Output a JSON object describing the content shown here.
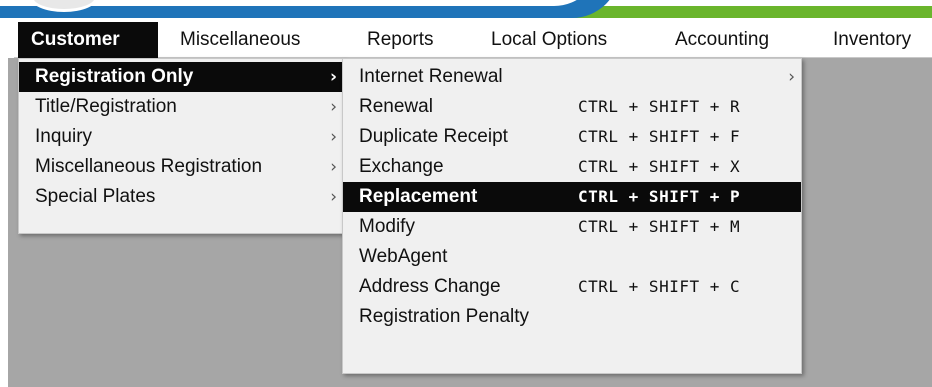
{
  "menubar": {
    "items": [
      {
        "label": "Customer"
      },
      {
        "label": "Miscellaneous"
      },
      {
        "label": "Reports"
      },
      {
        "label": "Local Options"
      },
      {
        "label": "Accounting"
      },
      {
        "label": "Inventory"
      }
    ]
  },
  "customer_menu": {
    "items": [
      {
        "label": "Registration Only",
        "chevron": "›",
        "highlighted": true
      },
      {
        "label": "Title/Registration",
        "chevron": "›"
      },
      {
        "label": "Inquiry",
        "chevron": "›"
      },
      {
        "label": "Miscellaneous Registration",
        "chevron": "›"
      },
      {
        "label": "Special Plates",
        "chevron": "›"
      }
    ]
  },
  "registration_submenu": {
    "items": [
      {
        "label": "Internet Renewal",
        "chevron": "›",
        "shortcut": ""
      },
      {
        "label": "Renewal",
        "shortcut": "CTRL + SHIFT + R"
      },
      {
        "label": "Duplicate Receipt",
        "shortcut": "CTRL + SHIFT + F"
      },
      {
        "label": "Exchange",
        "shortcut": "CTRL + SHIFT + X"
      },
      {
        "label": "Replacement",
        "shortcut": "CTRL + SHIFT + P",
        "highlighted": true
      },
      {
        "label": "Modify",
        "shortcut": "CTRL + SHIFT + M"
      },
      {
        "label": "WebAgent",
        "shortcut": ""
      },
      {
        "label": "Address Change",
        "shortcut": "CTRL + SHIFT + C"
      },
      {
        "label": "Registration Penalty",
        "shortcut": ""
      }
    ]
  },
  "colors": {
    "highlight_bg": "#0a0a0a",
    "menu_bg": "#f0f0f0",
    "workspace_bg": "#a6a6a6",
    "banner_blue": "#1f74b9",
    "banner_green": "#6ab52c"
  }
}
